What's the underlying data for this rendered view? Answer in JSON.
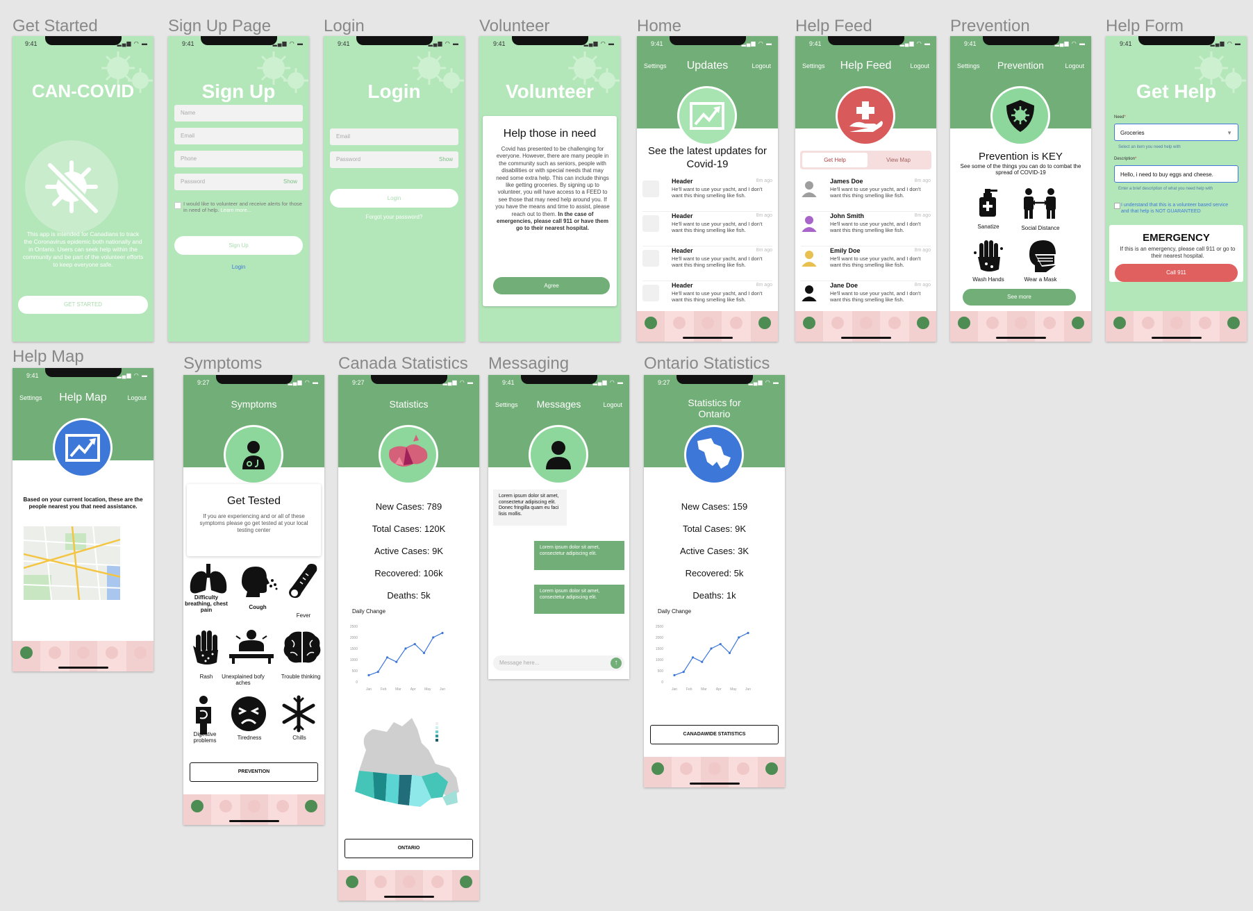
{
  "status_time_a": "9:41",
  "status_time_b": "9:27",
  "nav": {
    "settings": "Settings",
    "logout": "Logout"
  },
  "frames": {
    "get_started": "Get Started",
    "sign_up": "Sign Up Page",
    "login": "Login",
    "volunteer": "Volunteer",
    "home": "Home",
    "help_feed": "Help Feed",
    "prevention": "Prevention",
    "help_form": "Help Form",
    "help_map": "Help Map",
    "symptoms": "Symptoms",
    "canada_stats": "Canada Statistics",
    "messaging": "Messaging",
    "ontario_stats": "Ontario Statistics"
  },
  "get_started": {
    "title": "CAN-COVID",
    "body": "This app is intended for Canadians to track the Coronavirus epidemic both nationally and in Ontario. Users can seek help within the community and be part of the volunteer efforts to keep everyone safe.",
    "button": "GET STARTED"
  },
  "sign_up": {
    "title": "Sign Up",
    "name": "Name",
    "email": "Email",
    "phone": "Phone",
    "password": "Password",
    "show": "Show",
    "consent": "I would like to volunteer and receive alerts for those in need of help.",
    "learn_more": "Learn more...",
    "button": "Sign Up",
    "login_link": "Login"
  },
  "login": {
    "title": "Login",
    "email": "Email",
    "password": "Password",
    "show": "Show",
    "button": "Login",
    "forgot": "Forgot your password?"
  },
  "volunteer": {
    "title": "Volunteer",
    "card_title": "Help those in need",
    "body": "Covid has presented to be challenging for everyone. However, there are many people in the community such as seniors, people with disabilities or with special needs that may need some extra help. This can include things like getting groceries. By signing up to volunteer, you will have access to a FEED to see those that may need help around you. If you have the means and  time to assist, please reach out to them.",
    "emergency": "In the case of emergencies, please call 911 or have them go to their nearest hospital.",
    "button": "Agree"
  },
  "home": {
    "title": "Updates",
    "headline": "See the latest updates for Covid-19",
    "items": [
      {
        "header": "Header",
        "ago": "8m ago",
        "body": "He'll want to use your yacht, and I don't want this thing smelling like fish."
      },
      {
        "header": "Header",
        "ago": "8m ago",
        "body": "He'll want to use your yacht, and I don't want this thing smelling like fish."
      },
      {
        "header": "Header",
        "ago": "8m ago",
        "body": "He'll want to use your yacht, and I don't want this thing smelling like fish."
      },
      {
        "header": "Header",
        "ago": "8m ago",
        "body": "He'll want to use your yacht, and I don't want this thing smelling like fish."
      }
    ]
  },
  "help_feed": {
    "title": "Help Feed",
    "tab_help": "Get Help",
    "tab_map": "View Map",
    "items": [
      {
        "name": "James Doe",
        "ago": "8m ago",
        "body": "He'll want to use your yacht, and I don't want this thing smelling like fish.",
        "color": "#9e9e9e"
      },
      {
        "name": "John Smith",
        "ago": "8m ago",
        "body": "He'll want to use your yacht, and I don't want this thing smelling like fish.",
        "color": "#a864c8"
      },
      {
        "name": "Emily Doe",
        "ago": "8m ago",
        "body": "He'll want to use your yacht, and I don't want this thing smelling like fish.",
        "color": "#e8c050"
      },
      {
        "name": "Jane Doe",
        "ago": "8m ago",
        "body": "He'll want to use your yacht, and I don't want this thing smelling like fish.",
        "color": "#111111"
      }
    ]
  },
  "prevention": {
    "title": "Prevention",
    "headline": "Prevention is KEY",
    "sub": "See some of the things you can do to combat the spread of COVID-19",
    "items": [
      "Sanatize",
      "Social Distance",
      "Wash Hands",
      "Wear a Mask"
    ],
    "button": "See more"
  },
  "help_form": {
    "title": "Get Help",
    "need_label": "Need",
    "need_value": "Groceries",
    "need_hint": "Select an item you need help with",
    "desc_label": "Description",
    "desc_value": "Hello, i need to buy eggs and cheese.",
    "desc_hint": "Enter a brief description of what you need help with",
    "consent": "I understand that this is a volunteer based service and that help is NOT GUARANTEED",
    "emergency_title": "EMERGENCY",
    "emergency_body": "If this is an emergency, please call 911 or go to their nearest hospital.",
    "call": "Call 911"
  },
  "help_map": {
    "title": "Help Map",
    "body": "Based on your current location, these are the people nearest you that need assistance."
  },
  "symptoms": {
    "title": "Symptoms",
    "card_title": "Get Tested",
    "card_body": "If you are experiencing and or all of these symptoms please go get tested at your local testing center",
    "items": [
      "Difficulty breathing, chest pain",
      "Cough",
      "Fever",
      "Rash",
      "Unexplained bofy aches",
      "Trouble thinking",
      "Digestive problems",
      "Tiredness",
      "Chills"
    ],
    "button": "PREVENTION"
  },
  "canada": {
    "title": "Statistics",
    "new_cases": "New Cases: 789",
    "total_cases": "Total Cases: 120K",
    "active_cases": "Active Cases: 9K",
    "recovered": "Recovered: 106k",
    "deaths": "Deaths: 5k",
    "chart_title": "Daily Change",
    "button": "ONTARIO"
  },
  "messaging": {
    "title": "Messages",
    "received": "Lorem ipsum dolor sit amet, consectetur adipiscing elit. Donec fringilla quam eu faci lisis mollis.",
    "sent1": "Lorem ipsum dolor sit amet, consectetur adipiscing elit.",
    "sent2": "Lorem ipsum dolor sit amet, consectetur adipiscing elit.",
    "placeholder": "Message here..."
  },
  "ontario": {
    "title": "Statistics for Ontario",
    "new_cases": "New Cases: 159",
    "total_cases": "Total Cases: 9K",
    "active_cases": "Active Cases: 3K",
    "recovered": "Recovered: 5k",
    "deaths": "Deaths: 1k",
    "chart_title": "Daily Change",
    "button": "CANADAWIDE STATISTICS"
  },
  "colors": {
    "green_dark": "#72ae77",
    "green_light": "#b3e6b9",
    "red": "#e06060",
    "blue": "#3d78d8"
  },
  "chart_data": [
    {
      "type": "line",
      "title": "Daily Change",
      "categories": [
        "Jan",
        "Feb",
        "Mar",
        "Apr",
        "May",
        "Jun"
      ],
      "y_ticks": [
        0,
        500,
        1000,
        1500,
        2000,
        2500
      ],
      "ylim": [
        0,
        2500
      ],
      "series": [
        {
          "values": [
            300,
            450,
            1100,
            900,
            1500,
            1700,
            1300,
            2000,
            2200
          ]
        }
      ]
    },
    {
      "type": "line",
      "title": "Daily Change",
      "categories": [
        "Jan",
        "Feb",
        "Mar",
        "Apr",
        "May",
        "Jun"
      ],
      "y_ticks": [
        0,
        500,
        1000,
        1500,
        2000,
        2500
      ],
      "ylim": [
        0,
        2500
      ],
      "series": [
        {
          "values": [
            300,
            450,
            1100,
            900,
            1500,
            1700,
            1300,
            2000,
            2200
          ]
        }
      ]
    }
  ]
}
